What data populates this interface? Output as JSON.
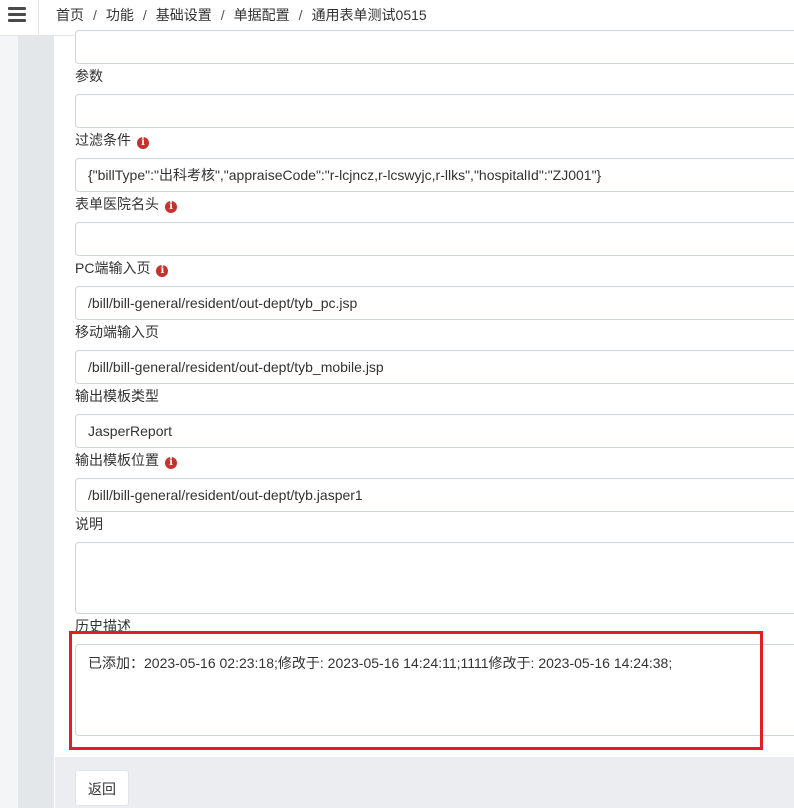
{
  "breadcrumb": {
    "items": [
      "首页",
      "功能",
      "基础设置",
      "单据配置",
      "通用表单测试0515"
    ],
    "separator": "/"
  },
  "form": {
    "top_field_value": "",
    "params": {
      "label": "参数",
      "value": ""
    },
    "filter": {
      "label": "过滤条件",
      "value": "{\"billType\":\"出科考核\",\"appraiseCode\":\"r-lcjncz,r-lcswyjc,r-llks\",\"hospitalId\":\"ZJ001\"}"
    },
    "hospital_header": {
      "label": "表单医院名头",
      "value": ""
    },
    "pc_input": {
      "label": "PC端输入页",
      "value": "/bill/bill-general/resident/out-dept/tyb_pc.jsp"
    },
    "mobile_input": {
      "label": "移动端输入页",
      "value": "/bill/bill-general/resident/out-dept/tyb_mobile.jsp"
    },
    "template_type": {
      "label": "输出模板类型",
      "value": "JasperReport"
    },
    "template_location": {
      "label": "输出模板位置",
      "value": "/bill/bill-general/resident/out-dept/tyb.jasper1"
    },
    "description": {
      "label": "说明",
      "value": ""
    },
    "history": {
      "label": "历史描述",
      "value": "已添加：2023-05-16 02:23:18;修改于: 2023-05-16 14:24:11;1111修改于: 2023-05-16 14:24:38;"
    }
  },
  "footer": {
    "back_label": "返回"
  },
  "icons": {
    "info": "info-icon",
    "menu": "hamburger-menu-icon"
  },
  "colors": {
    "highlight": "#e02020",
    "info_icon": "#c9302c",
    "sidebar": "#e4e7ea",
    "footer": "#ebedf0"
  }
}
